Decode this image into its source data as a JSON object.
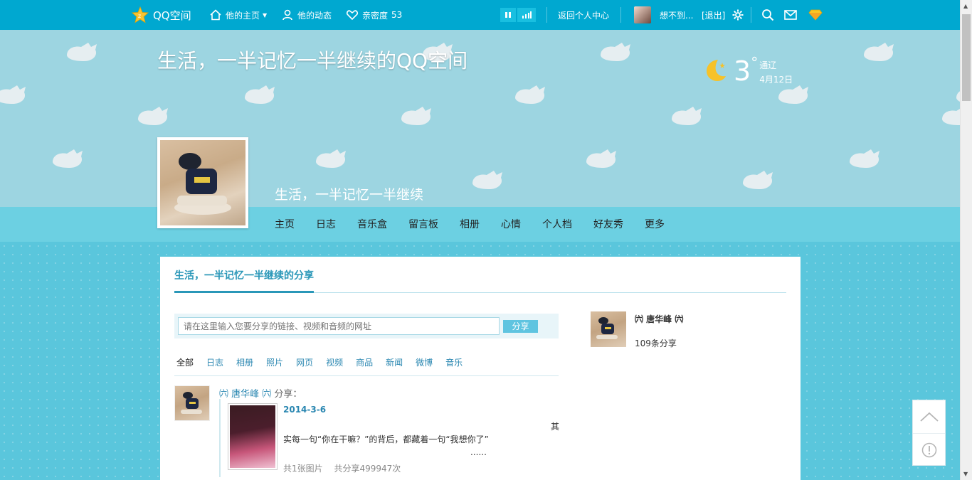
{
  "topbar": {
    "brand": "QQ空间",
    "his_home": "他的主页",
    "his_feed": "他的动态",
    "intimacy_label": "亲密度",
    "intimacy_value": "53",
    "back_center": "返回个人中心",
    "username": "想不到...",
    "logout": "[退出]"
  },
  "banner": {
    "space_title": "生活，一半记忆一半继续的QQ空间",
    "weather_temp": "3",
    "weather_deg": "°",
    "weather_city": "通辽",
    "weather_date": "4月12日",
    "profile_name": "生活，一半记忆一半继续"
  },
  "nav": {
    "tabs": [
      "主页",
      "日志",
      "音乐盒",
      "留言板",
      "相册",
      "心情",
      "个人档",
      "好友秀",
      "更多"
    ]
  },
  "share": {
    "title": "生活，一半记忆一半继续的分享",
    "placeholder": "请在这里输入您要分享的链接、视频和音频的网址",
    "button": "分享",
    "filters": [
      "全部",
      "日志",
      "相册",
      "照片",
      "网页",
      "视频",
      "商品",
      "新闻",
      "微博",
      "音乐"
    ]
  },
  "feed": {
    "author": "㈥ 唐华峰 ㈥",
    "verb": "分享：",
    "date": "2014-3-6",
    "qi": "其",
    "text": "实每一句“你在干嘛？”的背后，都藏着一句“我想你了”",
    "more": "......",
    "pics": "共1张图片",
    "shares": "共分享499947次"
  },
  "sidebar": {
    "name": "㈥ 唐华峰 ㈥",
    "count": "109条分享"
  },
  "colors": {
    "topbar": "#00a8d0",
    "banner": "#9dd5e1",
    "navband": "#6cd0e2",
    "link": "#2a87b1"
  }
}
